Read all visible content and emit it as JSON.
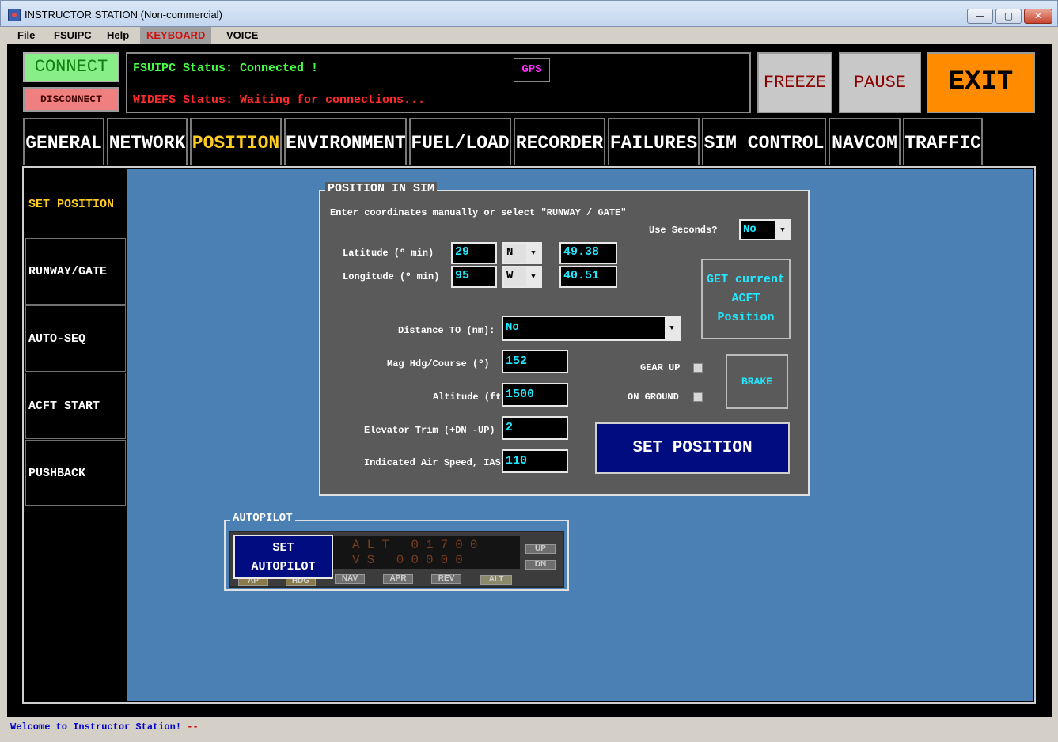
{
  "window": {
    "title": "INSTRUCTOR STATION (Non-commercial)",
    "min_glyph": "—",
    "max_glyph": "▢",
    "close_glyph": "✕"
  },
  "menu": {
    "items": [
      "File",
      "FSUIPC",
      "Help",
      "KEYBOARD",
      "VOICE"
    ],
    "highlight_color": "#d01010"
  },
  "top": {
    "connect": "CONNECT",
    "disconnect": "DISCONNECT",
    "fsuipc_status": "FSUIPC Status: Connected !",
    "widefs_status": "WIDEFS Status: Waiting for connections...",
    "gps": "GPS",
    "freeze": "FREEZE",
    "pause": "PAUSE",
    "exit": "EXIT"
  },
  "tabs": [
    "GENERAL",
    "NETWORK",
    "POSITION",
    "ENVIRONMENT",
    "FUEL/LOAD",
    "RECORDER",
    "FAILURES",
    "SIM CONTROL",
    "NAVCOM",
    "TRAFFIC"
  ],
  "active_tab": "POSITION",
  "sidebar": {
    "items": [
      "SET POSITION",
      "RUNWAY/GATE",
      "AUTO-SEQ",
      "ACFT START",
      "PUSHBACK"
    ],
    "active": "SET POSITION"
  },
  "position": {
    "group_title": "POSITION IN SIM",
    "instructions": "Enter coordinates manually or select \"RUNWAY / GATE\"",
    "use_seconds_label": "Use Seconds?",
    "use_seconds_value": "No",
    "latitude_label": "Latitude (º min)",
    "latitude_deg": "29",
    "latitude_hemi": "N",
    "latitude_min": "49.38",
    "longitude_label": "Longitude (º min)",
    "longitude_deg": "95",
    "longitude_hemi": "W",
    "longitude_min": "40.51",
    "get_current_btn": [
      "GET current",
      "ACFT",
      "Position"
    ],
    "distance_label": "Distance TO (nm):",
    "distance_value": "No",
    "heading_label": "Mag Hdg/Course (º)",
    "heading_value": "152",
    "altitude_label": "Altitude (ft)",
    "altitude_value": "1500",
    "trim_label": "Elevator Trim (+DN -UP)",
    "trim_value": "2",
    "ias_label": "Indicated Air Speed, IAS",
    "ias_value": "110",
    "gear_up_label": "GEAR UP",
    "gear_up_checked": false,
    "on_ground_label": "ON GROUND",
    "on_ground_checked": false,
    "brake_btn": "BRAKE",
    "set_position_btn": "SET POSITION"
  },
  "autopilot": {
    "group_title": "AUTOPILOT",
    "display_line1": "ALT 01700",
    "display_line2": "VS  00000",
    "keys": [
      "AP",
      "HDG",
      "NAV",
      "APR",
      "REV",
      "ALT",
      "UP",
      "DN"
    ],
    "set_btn_line1": "SET",
    "set_btn_line2": "AUTOPILOT"
  },
  "statusbar": {
    "message": "Welcome to Instructor Station!",
    "suffix": " --"
  }
}
